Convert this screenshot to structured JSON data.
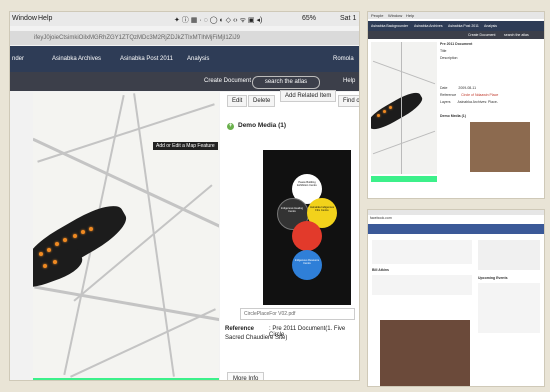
{
  "main": {
    "menubar": {
      "window": "Window",
      "help": "Help",
      "battery": "65%",
      "clock": "Sat 1"
    },
    "url": "ifeyJ0joieCtsimkiOilxMGRhZGY1ZTQzMDc3M2RjZDJkZTIxMTlhMjFiMjI1ZiJ9",
    "nav": {
      "items": [
        "nder",
        "Asinabka Archives",
        "Asinabka Post 2011",
        "Analysis"
      ],
      "right": "Romola"
    },
    "toolbar": {
      "create": "Create Document",
      "search": "search the atlas",
      "help": "Help"
    },
    "map_labels": {
      "edit": "Add or Edit a Map Feature"
    },
    "side": {
      "edit": "Edit",
      "delete": "Delete",
      "add_related": "Add Related Item",
      "find_on_map": "Find on Ma",
      "demo_media": "Demo Media (1)",
      "caption_placeholder": "CirclePlaceFor V02.pdf",
      "ref_label": "Reference",
      "ref_value": ": Pre 2011 Document(1. Five Circle",
      "ref_value2": "Sacred Chaudiere Site)",
      "more_info": "More Info"
    },
    "diagram_labels": {
      "top": "Peace Building Exhibition Centre",
      "left": "Indigenous Healing Centre",
      "right": "Asinabka Indigenous Film Centre",
      "bottom": "Indigenous Resource Centre"
    }
  },
  "top_right": {
    "menu": {
      "people": "People",
      "window": "Window",
      "help": "Help"
    },
    "nav": [
      "Asinabka Backgrounder",
      "Asinabka Archives",
      "Asinabka Post 2011",
      "Analysis"
    ],
    "tool": {
      "create": "Create Document",
      "search": "search the atlas"
    },
    "panel": {
      "title": "Pre 2011 Document",
      "rows": [
        "Title",
        "Description",
        "Date",
        "Reference",
        "Layers"
      ],
      "date": "2009-08-11",
      "reference": "Circle of Ndaawin Place",
      "layers": "Asinabka Archives: Place-"
    },
    "media": "Demo Media (1)"
  },
  "bottom_right": {
    "url": "facebook.com",
    "post_author": "Bill Atkins",
    "events": "Upcoming Events",
    "colors": {
      "fb": "#3b5998"
    }
  },
  "colors": {
    "nav": "#2e3c56",
    "toolbar": "#3c3f4a",
    "green": "#3cf08a",
    "dot": "#f08a22"
  }
}
